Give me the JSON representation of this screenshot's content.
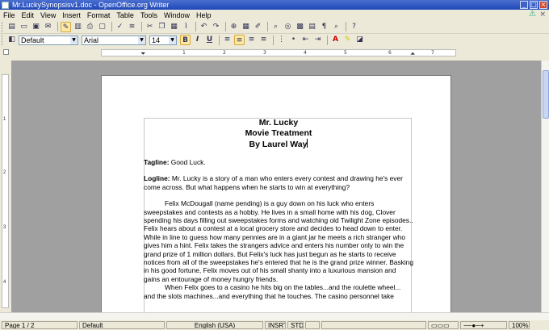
{
  "window": {
    "title": "Mr.LuckySynopsisv1.doc - OpenOffice.org Writer",
    "minimize": "_",
    "maximize": "□",
    "close": "×"
  },
  "menu": [
    "File",
    "Edit",
    "View",
    "Insert",
    "Format",
    "Table",
    "Tools",
    "Window",
    "Help"
  ],
  "menu_close": "×",
  "formatting": {
    "style": "Default",
    "font": "Arial",
    "size": "14",
    "bold": "B",
    "italic": "I",
    "underline": "U"
  },
  "ruler": {
    "ticks": [
      "1",
      "2",
      "3",
      "4",
      "5",
      "6",
      "7"
    ]
  },
  "vruler": {
    "ticks": [
      "1",
      "2",
      "3",
      "4"
    ]
  },
  "document": {
    "heading": [
      "Mr. Lucky",
      "Movie Treatment",
      "By Laurel Way"
    ],
    "tagline_label": "Tagline:",
    "tagline_text": " Good Luck.",
    "logline_label": "Logline:",
    "logline_text": " Mr. Lucky is a story of a man who enters every contest and drawing he's ever come across. But what happens when he starts to win at everything?",
    "para1": "Felix McDougall (name pending) is a guy down on his luck who enters sweepstakes and contests as a hobby. He lives in a small home with his dog, Clover spending his days filling out sweepstakes forms and watching old Twilight Zone episodes.. Felix hears about a contest at a local grocery store and decides to head down to enter. While in line to guess how many pennies are in a giant jar he meets a rich stranger who gives him a hint. Felix takes the strangers advice and enters his number only to win the grand prize of 1 million dollars. But Felix's luck has just begun as he starts to receive notices from all of the sweepstakes he's entered that he is the grand prize winner. Basking in his good fortune, Felix moves out of his small shanty into a luxurious mansion and gains an entourage of money hungry friends.",
    "para2": "When Felix goes to a casino he hits big on the tables...and the roulette wheel... and the slots machines...and everything that he touches. The casino personnel take"
  },
  "status": {
    "page": "Page 1 / 2",
    "style": "Default",
    "language": "English (USA)",
    "insert": "INSRT",
    "selection": "STD",
    "zoom": "100%"
  }
}
